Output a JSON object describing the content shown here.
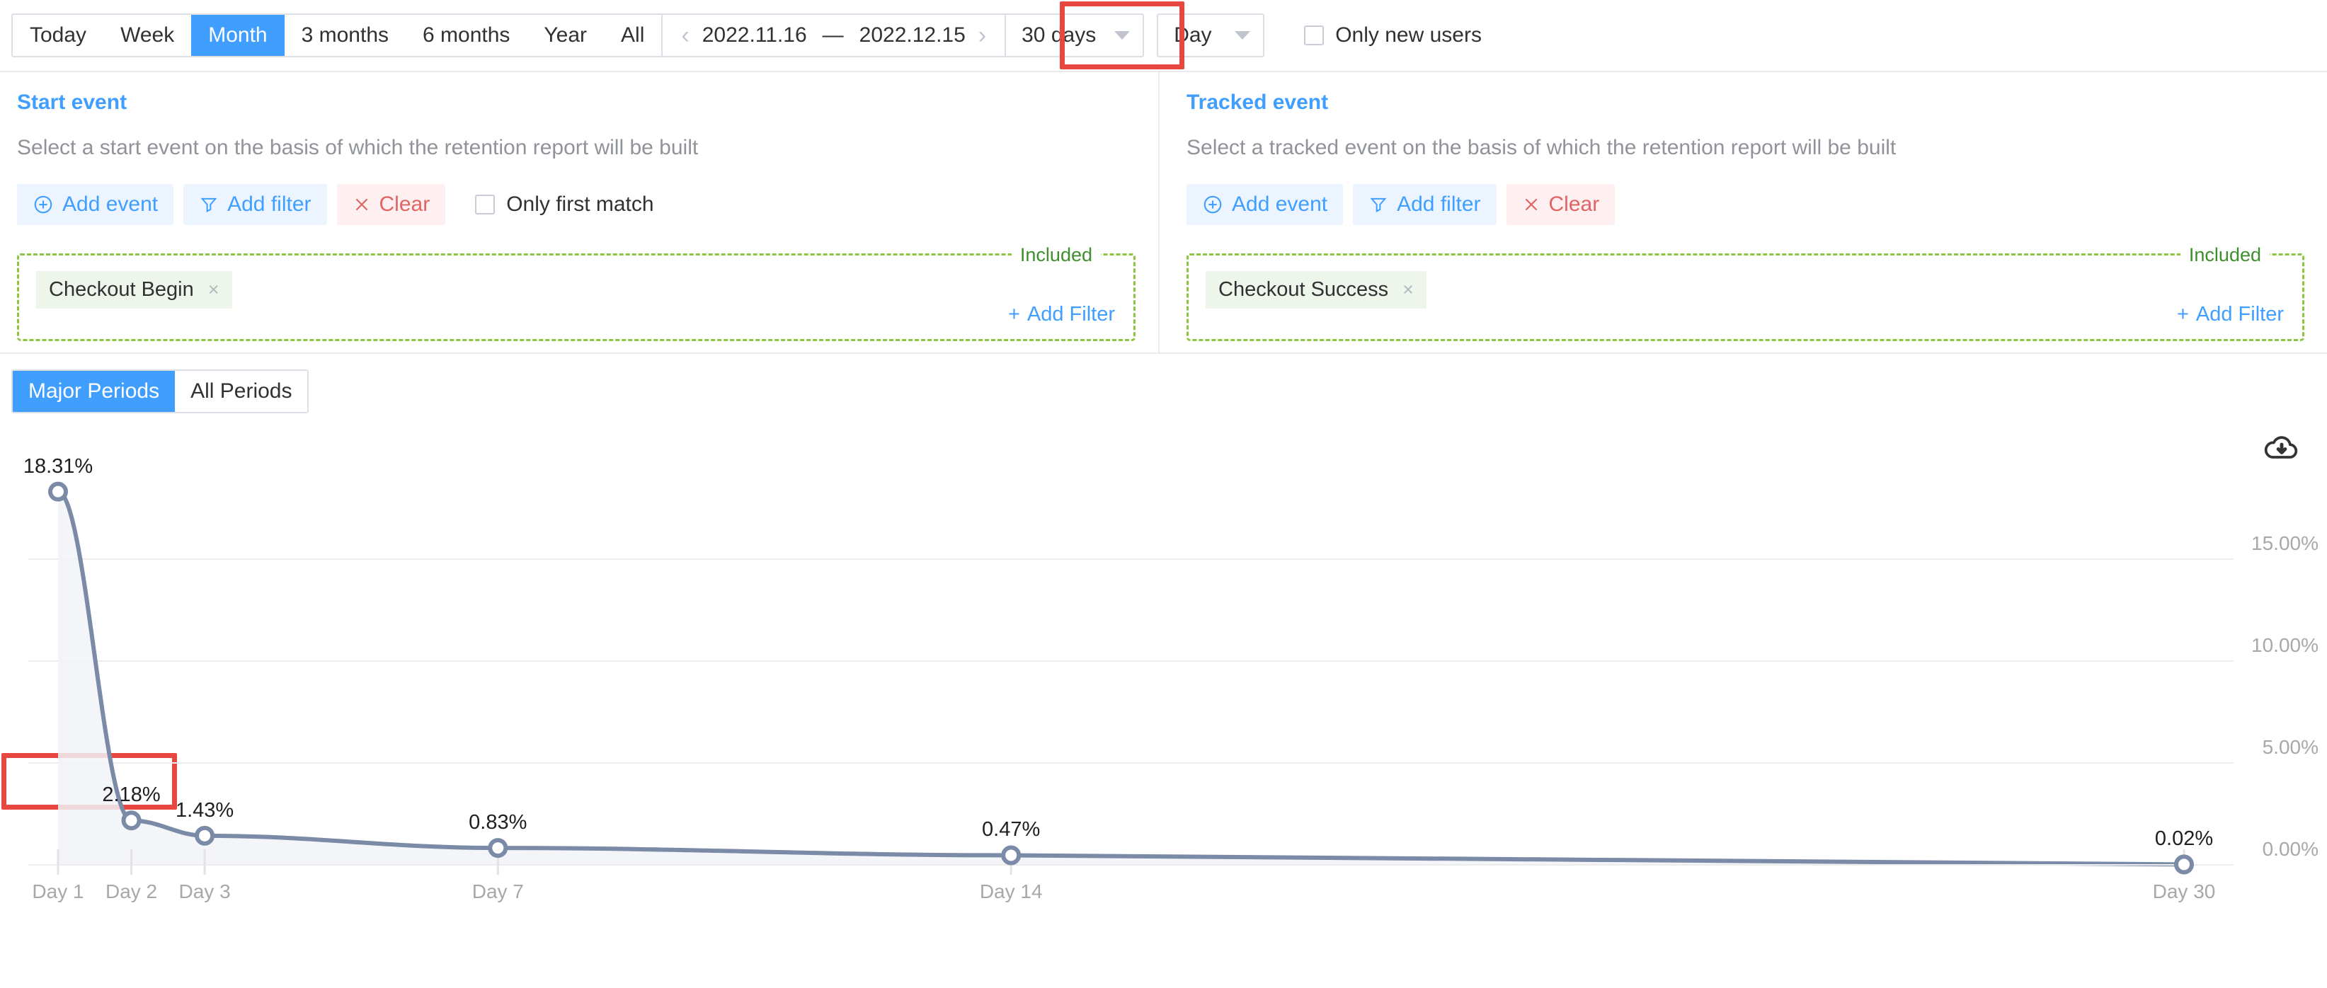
{
  "toolbar": {
    "ranges": [
      {
        "label": "Today",
        "active": false
      },
      {
        "label": "Week",
        "active": false
      },
      {
        "label": "Month",
        "active": true
      },
      {
        "label": "3 months",
        "active": false
      },
      {
        "label": "6 months",
        "active": false
      },
      {
        "label": "Year",
        "active": false
      },
      {
        "label": "All",
        "active": false
      }
    ],
    "prev_arrow": "‹",
    "next_arrow": "›",
    "date_start": "2022.11.16",
    "date_dash": "—",
    "date_end": "2022.12.15",
    "window_select": "30 days",
    "granularity_select": "Day",
    "only_new_users_label": "Only new users",
    "only_new_users_checked": false,
    "highlight_color": "#e8473f",
    "accent_color": "#409eff"
  },
  "start_event": {
    "title": "Start event",
    "subtitle": "Select a start event on the basis of which the retention report will be built",
    "add_event_label": "Add event",
    "add_filter_label": "Add filter",
    "clear_label": "Clear",
    "only_first_match_label": "Only first match",
    "only_first_match_checked": false,
    "included_label": "Included",
    "chips": [
      {
        "label": "Checkout Begin",
        "remove": "×"
      }
    ],
    "add_filter_link": "Add Filter",
    "add_filter_plus": "+"
  },
  "tracked_event": {
    "title": "Tracked event",
    "subtitle": "Select a tracked event on the basis of which the retention report will be built",
    "add_event_label": "Add event",
    "add_filter_label": "Add filter",
    "clear_label": "Clear",
    "included_label": "Included",
    "chips": [
      {
        "label": "Checkout Success",
        "remove": "×"
      }
    ],
    "add_filter_link": "Add Filter",
    "add_filter_plus": "+"
  },
  "period_tabs": [
    {
      "label": "Major Periods",
      "active": true
    },
    {
      "label": "All Periods",
      "active": false
    }
  ],
  "chart_icons": {
    "download": "cloud-download-icon"
  },
  "chart_data": {
    "type": "line",
    "title": "",
    "subtitle": "",
    "xlabel": "",
    "ylabel": "",
    "x": [
      "Day 1",
      "Day 2",
      "Day 3",
      "Day 7",
      "Day 14",
      "Day 30"
    ],
    "x_index": [
      1,
      2,
      3,
      7,
      14,
      30
    ],
    "values": [
      18.31,
      2.18,
      1.43,
      0.83,
      0.47,
      0.02
    ],
    "point_labels": [
      "18.31%",
      "2.18%",
      "1.43%",
      "0.83%",
      "0.47%",
      "0.02%"
    ],
    "xtick_labels": [
      "Day 1",
      "Day 2",
      "Day 3",
      "Day 7",
      "Day 14",
      "Day 30"
    ],
    "ytick_labels": [
      "0.00%",
      "5.00%",
      "10.00%",
      "15.00%"
    ],
    "ytick_values": [
      0,
      5,
      10,
      15
    ],
    "ylim": [
      0,
      19.2
    ],
    "xlim": [
      1,
      30
    ],
    "grid": true,
    "legend": "none",
    "series_color": "#7b8aa6",
    "area_fill": "#f1f3f7",
    "marker": "open-circle"
  }
}
